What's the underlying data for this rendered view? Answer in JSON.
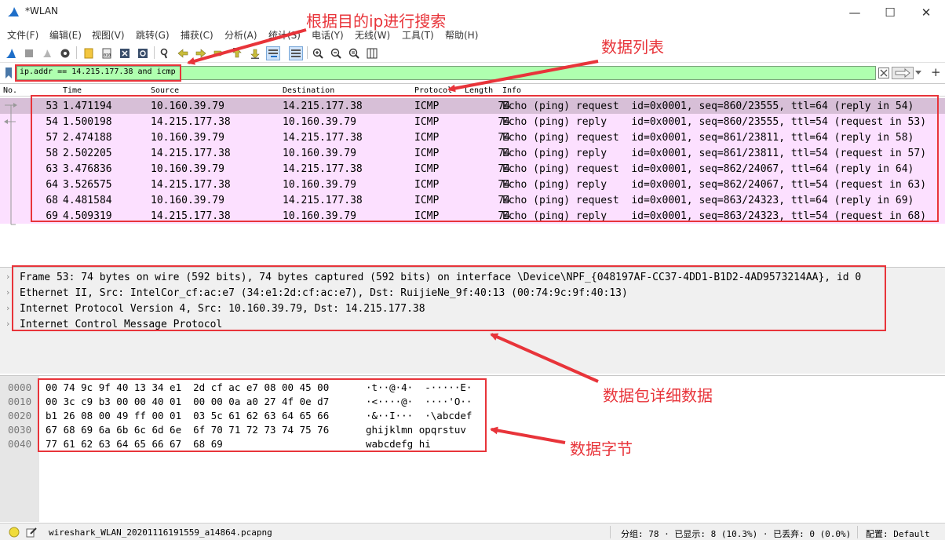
{
  "window": {
    "title": "*WLAN",
    "min": "—",
    "max": "☐",
    "close": "✕"
  },
  "menu": [
    "文件(F)",
    "编辑(E)",
    "视图(V)",
    "跳转(G)",
    "捕获(C)",
    "分析(A)",
    "统计(S)",
    "电话(Y)",
    "无线(W)",
    "工具(T)",
    "帮助(H)"
  ],
  "filter": {
    "value": "ip.addr == 14.215.177.38 and icmp",
    "plus": "+"
  },
  "columns": [
    "No.",
    "Time",
    "Source",
    "Destination",
    "Protocol",
    "Length",
    "Info"
  ],
  "packets": [
    {
      "no": "53",
      "time": "1.471194",
      "src": "10.160.39.79",
      "dst": "14.215.177.38",
      "proto": "ICMP",
      "len": "74",
      "info": "Echo (ping) request  id=0x0001, seq=860/23555, ttl=64 (reply in 54)"
    },
    {
      "no": "54",
      "time": "1.500198",
      "src": "14.215.177.38",
      "dst": "10.160.39.79",
      "proto": "ICMP",
      "len": "74",
      "info": "Echo (ping) reply    id=0x0001, seq=860/23555, ttl=54 (request in 53)"
    },
    {
      "no": "57",
      "time": "2.474188",
      "src": "10.160.39.79",
      "dst": "14.215.177.38",
      "proto": "ICMP",
      "len": "74",
      "info": "Echo (ping) request  id=0x0001, seq=861/23811, ttl=64 (reply in 58)"
    },
    {
      "no": "58",
      "time": "2.502205",
      "src": "14.215.177.38",
      "dst": "10.160.39.79",
      "proto": "ICMP",
      "len": "74",
      "info": "Echo (ping) reply    id=0x0001, seq=861/23811, ttl=54 (request in 57)"
    },
    {
      "no": "63",
      "time": "3.476836",
      "src": "10.160.39.79",
      "dst": "14.215.177.38",
      "proto": "ICMP",
      "len": "74",
      "info": "Echo (ping) request  id=0x0001, seq=862/24067, ttl=64 (reply in 64)"
    },
    {
      "no": "64",
      "time": "3.526575",
      "src": "14.215.177.38",
      "dst": "10.160.39.79",
      "proto": "ICMP",
      "len": "74",
      "info": "Echo (ping) reply    id=0x0001, seq=862/24067, ttl=54 (request in 63)"
    },
    {
      "no": "68",
      "time": "4.481584",
      "src": "10.160.39.79",
      "dst": "14.215.177.38",
      "proto": "ICMP",
      "len": "74",
      "info": "Echo (ping) request  id=0x0001, seq=863/24323, ttl=64 (reply in 69)"
    },
    {
      "no": "69",
      "time": "4.509319",
      "src": "14.215.177.38",
      "dst": "10.160.39.79",
      "proto": "ICMP",
      "len": "74",
      "info": "Echo (ping) reply    id=0x0001, seq=863/24323, ttl=54 (request in 68)"
    }
  ],
  "details": [
    "Frame 53: 74 bytes on wire (592 bits), 74 bytes captured (592 bits) on interface \\Device\\NPF_{048197AF-CC37-4DD1-B1D2-4AD9573214AA}, id 0",
    "Ethernet II, Src: IntelCor_cf:ac:e7 (34:e1:2d:cf:ac:e7), Dst: RuijieNe_9f:40:13 (00:74:9c:9f:40:13)",
    "Internet Protocol Version 4, Src: 10.160.39.79, Dst: 14.215.177.38",
    "Internet Control Message Protocol"
  ],
  "bytes": [
    {
      "off": "0000",
      "hex": "00 74 9c 9f 40 13 34 e1  2d cf ac e7 08 00 45 00",
      "ascii": "·t··@·4·  -·····E·"
    },
    {
      "off": "0010",
      "hex": "00 3c c9 b3 00 00 40 01  00 00 0a a0 27 4f 0e d7",
      "ascii": "·<····@·  ····'O··"
    },
    {
      "off": "0020",
      "hex": "b1 26 08 00 49 ff 00 01  03 5c 61 62 63 64 65 66",
      "ascii": "·&··I···  ·\\abcdef"
    },
    {
      "off": "0030",
      "hex": "67 68 69 6a 6b 6c 6d 6e  6f 70 71 72 73 74 75 76",
      "ascii": "ghijklmn opqrstuv"
    },
    {
      "off": "0040",
      "hex": "77 61 62 63 64 65 66 67  68 69",
      "ascii": "wabcdefg hi"
    }
  ],
  "status": {
    "file": "wireshark_WLAN_20201116191559_a14864.pcapng",
    "stats": "分组: 78 · 已显示: 8 (10.3%) · 已丢弃: 0 (0.0%)",
    "profile": "配置: Default"
  },
  "annotations": {
    "search": "根据目的ip进行搜索",
    "list": "数据列表",
    "detail": "数据包详细数据",
    "bytes": "数据字节"
  },
  "colors": {
    "accent": "#e8343a",
    "filter_ok": "#afffaf",
    "icmp_row": "#fce0ff",
    "icmp_selected": "#d7bfd7"
  }
}
